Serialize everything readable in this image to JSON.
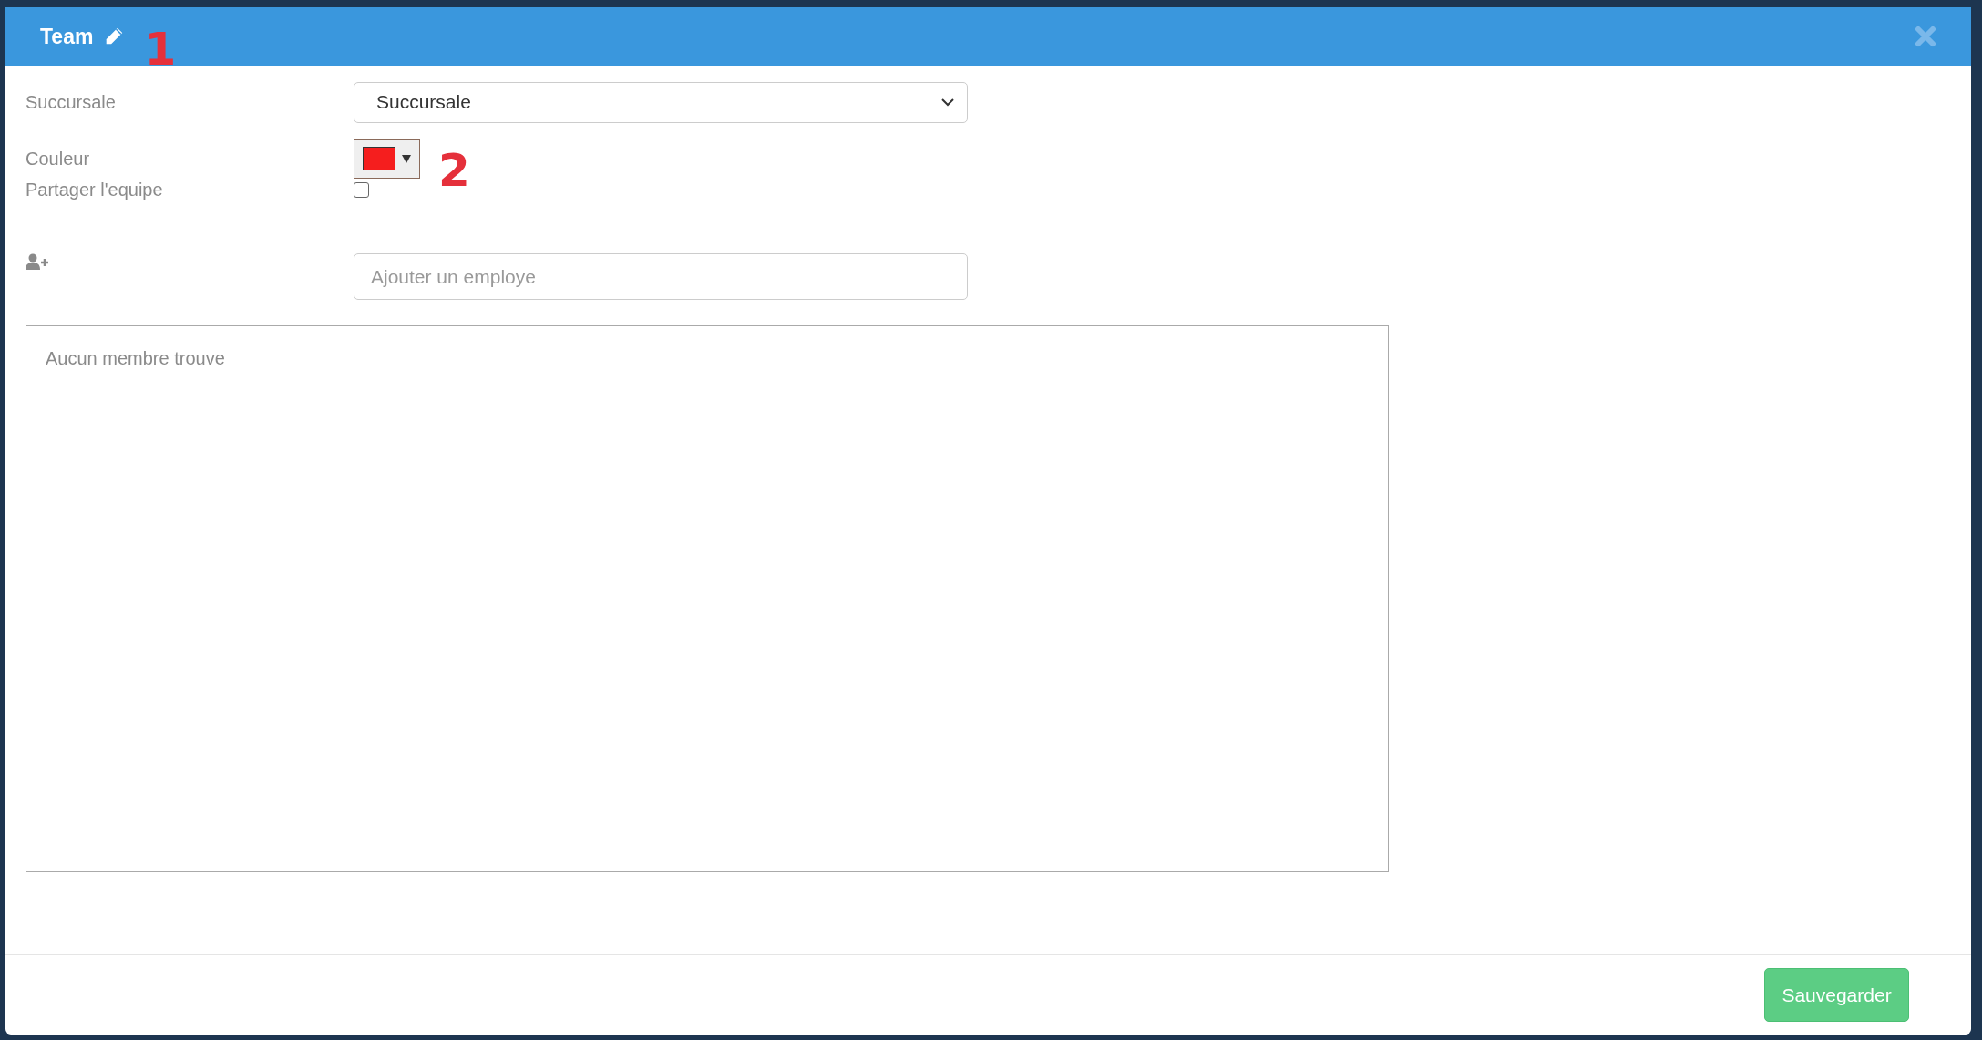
{
  "header": {
    "title": "Team",
    "annotation": "1"
  },
  "fields": [
    {
      "kind": "select",
      "label": "Succursale",
      "value": "Succursale"
    },
    {
      "kind": "color",
      "label": "Couleur",
      "color": "#f51e1e",
      "annotation": "2"
    },
    {
      "kind": "checkbox",
      "label": "Partager l'equipe",
      "checked": false
    }
  ],
  "add_employee": {
    "placeholder": "Ajouter un employe"
  },
  "members": {
    "empty_text": "Aucun membre trouve"
  },
  "footer": {
    "save_button": "Sauvegarder"
  }
}
